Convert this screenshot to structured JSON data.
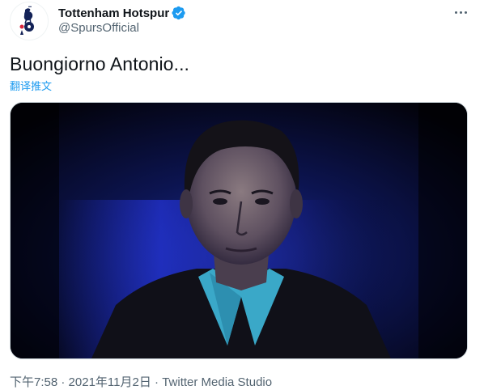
{
  "author": {
    "display_name": "Tottenham Hotspur",
    "handle": "@SpursOfficial",
    "verified": true,
    "avatar_icon": "spurs-cockerel-crest-icon",
    "verified_icon": "verified-badge-icon"
  },
  "tweet": {
    "text": "Buongiorno Antonio...",
    "translate_label": "翻译推文"
  },
  "media": {
    "type": "video",
    "icon": "video-frame-portrait"
  },
  "meta": {
    "time": "下午7:58",
    "separator1": " · ",
    "date": "2021年11月2日",
    "separator2": " · ",
    "source": "Twitter Media Studio"
  },
  "colors": {
    "link": "#1d9bf0",
    "secondary_text": "#536471",
    "primary_text": "#0f1419",
    "video_background": "#050514"
  }
}
